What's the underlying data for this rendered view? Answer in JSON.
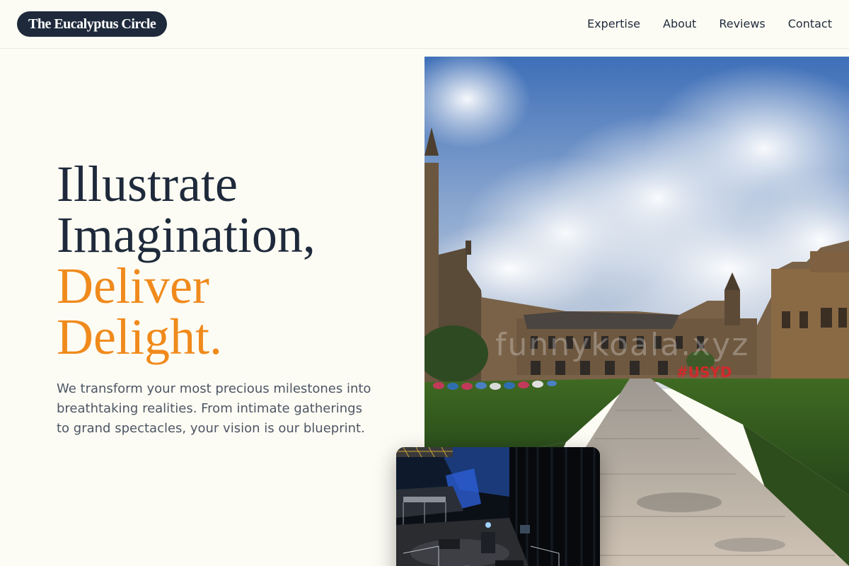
{
  "brand": {
    "name": "The Eucalyptus Circle"
  },
  "nav": {
    "items": [
      {
        "label": "Expertise"
      },
      {
        "label": "About"
      },
      {
        "label": "Reviews"
      },
      {
        "label": "Contact"
      }
    ]
  },
  "hero": {
    "headline_line1": "Illustrate",
    "headline_line2": "Imagination,",
    "headline_accent_line1": "Deliver",
    "headline_accent_line2": "Delight.",
    "description": "We transform your most precious milestones into breathtaking realities. From intimate gatherings to grand spectacles, your vision is our blueprint.",
    "main_image_watermark": "funnykoala.xyz",
    "main_image_sign": "#USYD"
  },
  "colors": {
    "background": "#fdfcf4",
    "navy": "#1e2a3b",
    "accent": "#f08a1c",
    "body_text": "#4d5665"
  }
}
